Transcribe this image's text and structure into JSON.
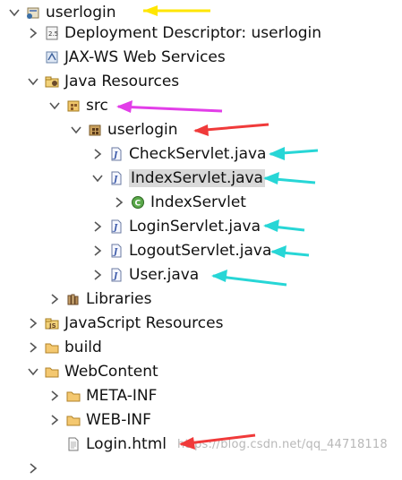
{
  "tree": {
    "project": "userlogin",
    "deployment_descriptor": "Deployment Descriptor: userlogin",
    "jaxws": "JAX-WS Web Services",
    "java_resources": "Java Resources",
    "src": "src",
    "package": "userlogin",
    "files": {
      "check": "CheckServlet.java",
      "index": "IndexServlet.java",
      "index_class": "IndexServlet",
      "login": "LoginServlet.java",
      "logout": "LogoutServlet.java",
      "user": "User.java"
    },
    "libraries": "Libraries",
    "js_resources": "JavaScript Resources",
    "build": "build",
    "webcontent": "WebContent",
    "metainf": "META-INF",
    "webinf": "WEB-INF",
    "login_html": "Login.html"
  },
  "watermark": "https://blog.csdn.net/qq_44718118",
  "colors": {
    "yellow_arrow": "#ffe600",
    "magenta_arrow": "#e23ee8",
    "red_arrow": "#f03a3a",
    "cyan_arrow": "#27d6d6",
    "selection": "#d9d9d9"
  }
}
